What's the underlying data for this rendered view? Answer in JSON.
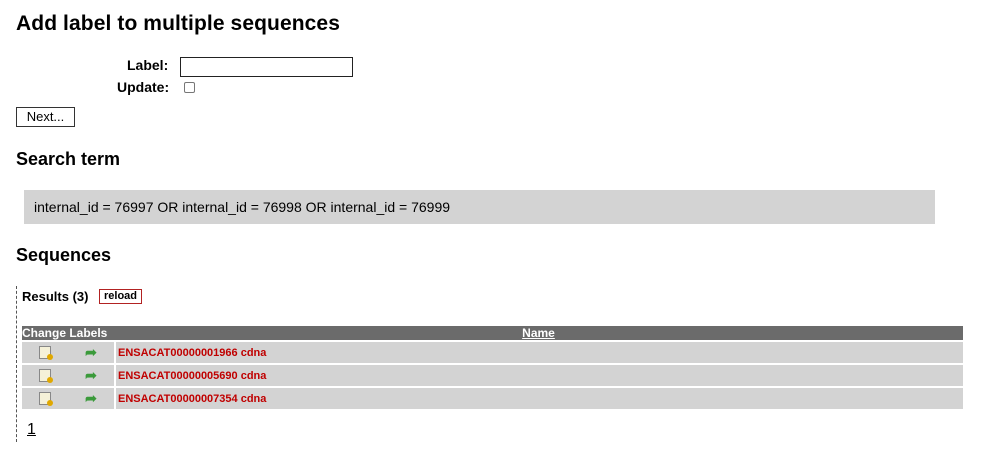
{
  "page": {
    "title": "Add label to multiple sequences"
  },
  "form": {
    "label_text": "Label:",
    "label_value": "",
    "update_text": "Update:",
    "update_checked": false,
    "next_button": "Next..."
  },
  "search": {
    "heading": "Search term",
    "term": "internal_id = 76997 OR internal_id = 76998 OR internal_id = 76999"
  },
  "sequences": {
    "heading": "Sequences",
    "results_label": "Results (3)",
    "reload_button": "reload",
    "columns": {
      "change_labels": "Change Labels",
      "name": "Name"
    },
    "rows": [
      {
        "name": "ENSACAT00000001966 cdna"
      },
      {
        "name": "ENSACAT00000005690 cdna"
      },
      {
        "name": "ENSACAT00000007354 cdna"
      }
    ],
    "icons": [
      "edit-label-icon",
      "apply-label-arrow-icon"
    ],
    "page_link": "1"
  },
  "colors": {
    "header_bg": "#6b6b6b",
    "row_bg": "#d3d3d3",
    "name_text": "#c00000",
    "reload_border": "#b22222"
  }
}
